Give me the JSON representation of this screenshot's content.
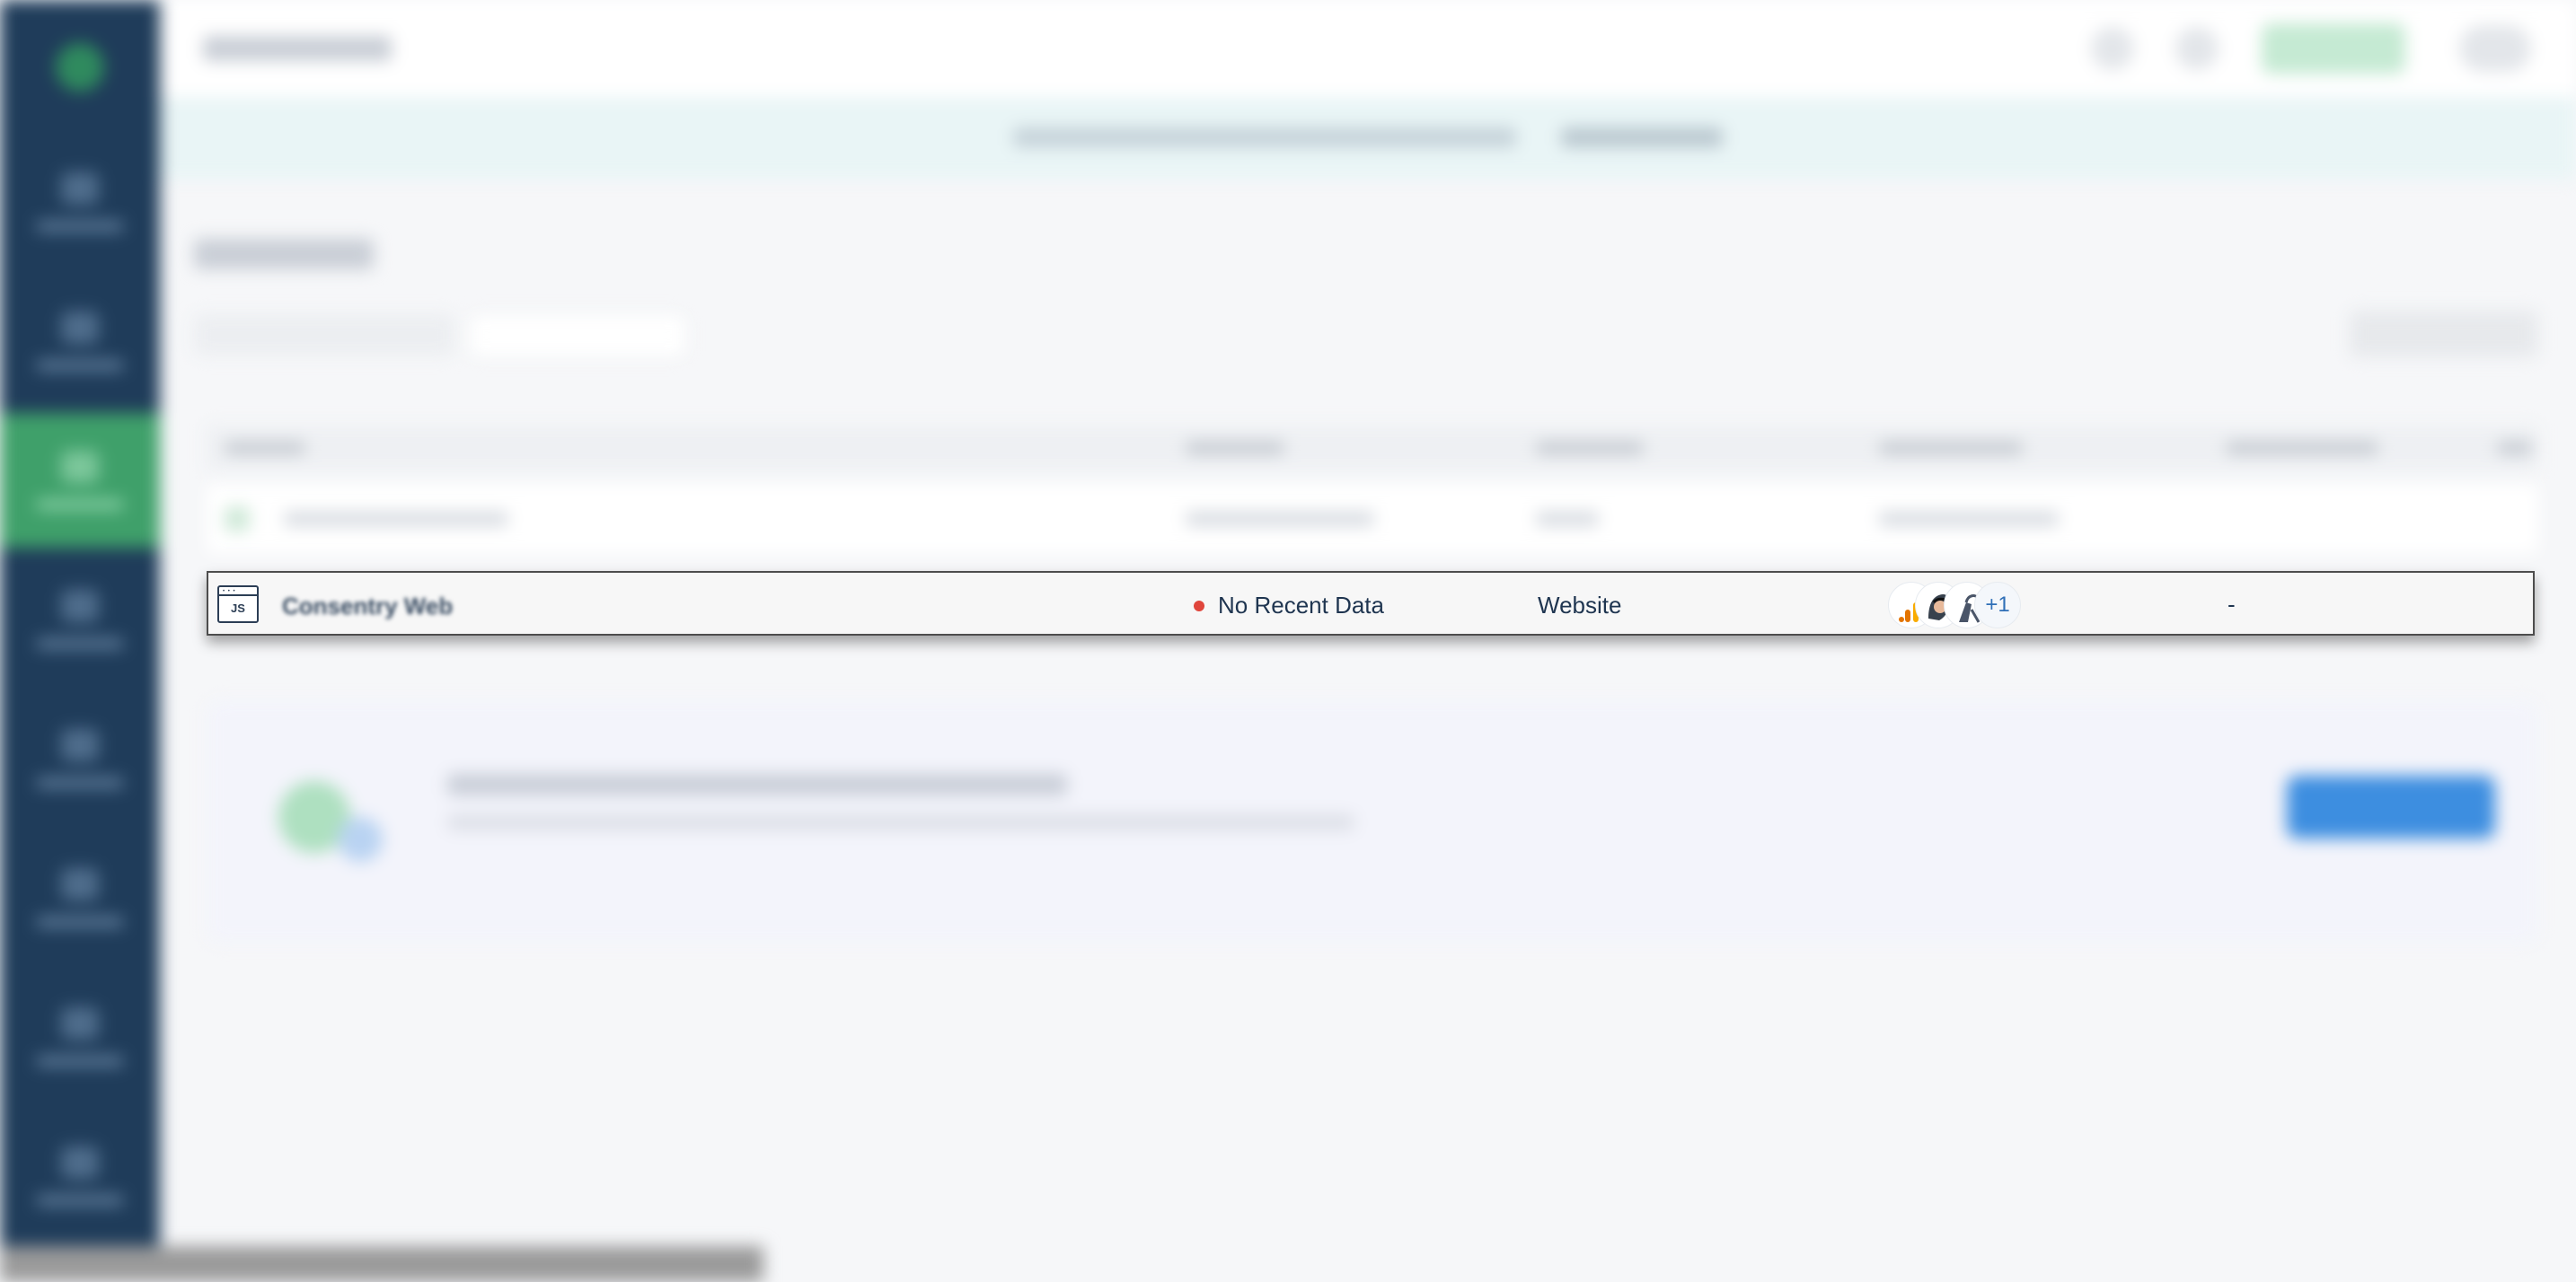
{
  "highlighted_row": {
    "type_icon_label": "JS",
    "name": "Consentry Web",
    "status": "No Recent Data",
    "category": "Website",
    "destinations_more": "+1",
    "last_seen": "-"
  },
  "colors": {
    "sidebar_bg": "#1f3c5a",
    "sidebar_active": "#3fa06a",
    "status_error": "#e0463c",
    "primary_button": "#3d8ee0",
    "row_border": "#4d4d4d"
  },
  "icons": {
    "type_icon": "javascript-source-icon",
    "destination_1": "google-analytics-icon",
    "destination_2": "mixpanel-avatar-icon",
    "destination_3": "zapier-hand-icon"
  }
}
